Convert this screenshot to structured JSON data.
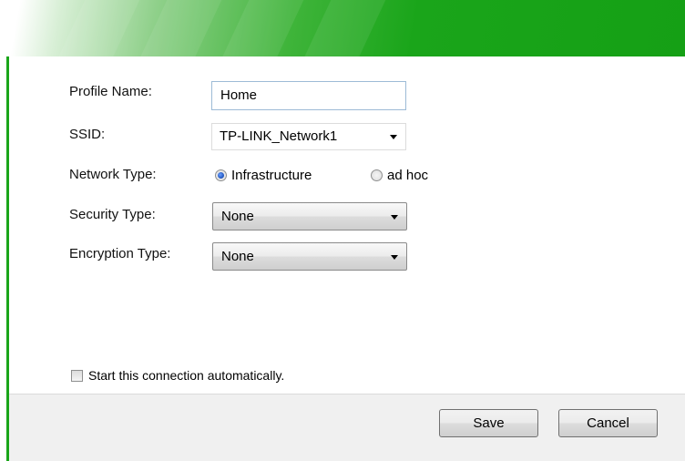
{
  "form": {
    "profile_name_label": "Profile Name:",
    "profile_name_value": "Home",
    "ssid_label": "SSID:",
    "ssid_value": "TP-LINK_Network1",
    "network_type_label": "Network Type:",
    "network_type_options": [
      {
        "label": "Infrastructure",
        "selected": true
      },
      {
        "label": "ad hoc",
        "selected": false
      }
    ],
    "security_type_label": "Security Type:",
    "security_type_value": "None",
    "encryption_type_label": "Encryption Type:",
    "encryption_type_value": "None"
  },
  "auto_connect": {
    "label": "Start this connection automatically.",
    "checked": false
  },
  "buttons": {
    "save_label": "Save",
    "cancel_label": "Cancel"
  },
  "colors": {
    "header_green": "#1aa51a",
    "footer_bg": "#f0f0f0"
  }
}
